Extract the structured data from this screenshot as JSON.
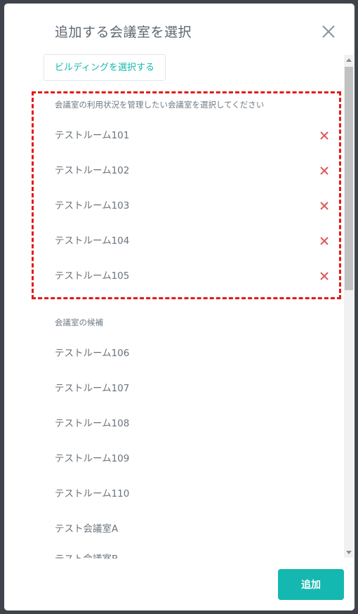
{
  "modal": {
    "title": "追加する会議室を選択",
    "building_button": "ビルディングを選択する",
    "selected_heading": "会議室の利用状況を管理したい会議室を選択してください",
    "selected_rooms": [
      "テストルーム101",
      "テストルーム102",
      "テストルーム103",
      "テストルーム104",
      "テストルーム105"
    ],
    "candidates_heading": "会議室の候補",
    "candidate_rooms": [
      "テストルーム106",
      "テストルーム107",
      "テストルーム108",
      "テストルーム109",
      "テストルーム110",
      "テスト会議室A",
      "テスト会議室B"
    ],
    "add_button": "追加"
  },
  "colors": {
    "accent": "#14b8b0",
    "remove": "#e05a5a",
    "highlight_border": "#e01b1b"
  },
  "icons": {
    "close": "close-icon",
    "remove": "remove-icon"
  }
}
